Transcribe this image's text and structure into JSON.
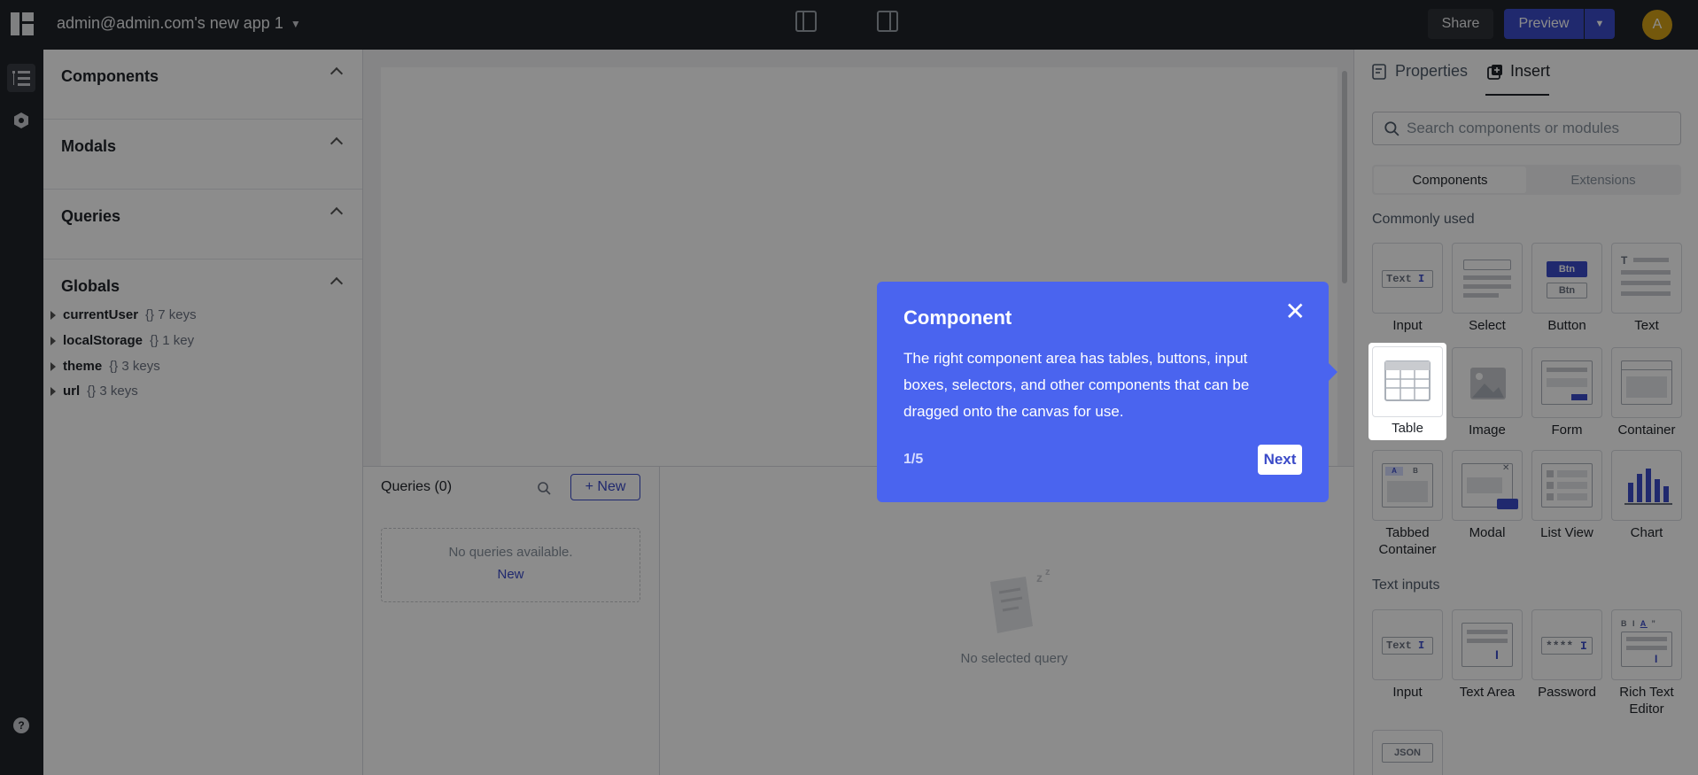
{
  "header": {
    "app_title": "admin@admin.com's new app 1",
    "share_label": "Share",
    "preview_label": "Preview",
    "avatar_initial": "A"
  },
  "left_panel": {
    "sections": [
      {
        "title": "Components"
      },
      {
        "title": "Modals"
      },
      {
        "title": "Queries"
      },
      {
        "title": "Globals"
      }
    ],
    "globals": [
      {
        "name": "currentUser",
        "value": "{} 7 keys"
      },
      {
        "name": "localStorage",
        "value": "{} 1 key"
      },
      {
        "name": "theme",
        "value": "{} 3 keys"
      },
      {
        "name": "url",
        "value": "{} 3 keys"
      }
    ]
  },
  "bottom_panel": {
    "queries_title": "Queries (0)",
    "new_label": "+ New",
    "empty_text": "No queries available.",
    "empty_link": "New",
    "no_selected": "No selected query"
  },
  "right_panel": {
    "tabs": [
      {
        "label": "Properties"
      },
      {
        "label": "Insert"
      }
    ],
    "search_placeholder": "Search components or modules",
    "segments": [
      "Components",
      "Extensions"
    ],
    "groups": [
      {
        "title": "Commonly used",
        "items": [
          "Input",
          "Select",
          "Button",
          "Text",
          "Table",
          "Image",
          "Form",
          "Container",
          "Tabbed Container",
          "Modal",
          "List View",
          "Chart"
        ]
      },
      {
        "title": "Text inputs",
        "items": [
          "Input",
          "Text Area",
          "Password",
          "Rich Text Editor"
        ]
      }
    ],
    "icon_texts": {
      "text_input": "Text",
      "btn": "Btn",
      "tab_a": "A",
      "tab_b": "B",
      "password": "****",
      "rte_bold": "B",
      "rte_italic": "I",
      "rte_underline": "A",
      "rte_quote": "”",
      "json": "JSON"
    }
  },
  "tooltip": {
    "title": "Component",
    "body": "The right component area has tables, buttons, input boxes, selectors, and other components that can be dragged onto the canvas for use.",
    "step": "1/5",
    "next_label": "Next"
  },
  "colors": {
    "accent": "#3b4bc8",
    "tooltip_bg": "#4a64ef",
    "topbar_bg": "#1f2329"
  }
}
